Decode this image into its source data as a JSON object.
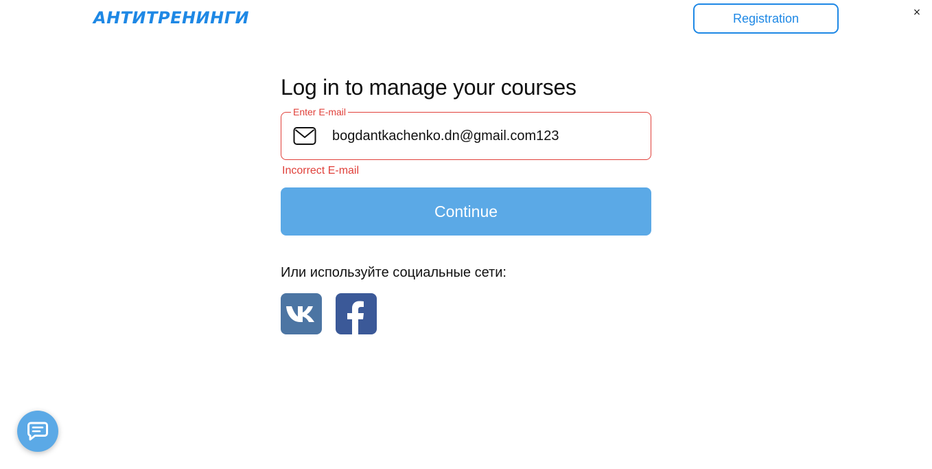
{
  "header": {
    "logo_text": "АНТИТРЕНИНГИ",
    "register_label": "Registration",
    "close_glyph": "×"
  },
  "login": {
    "heading": "Log in to manage your courses",
    "email": {
      "label": "Enter E-mail",
      "value": "bogdantkachenko.dn@gmail.com123",
      "icon": "envelope-icon",
      "error": "Incorrect E-mail"
    },
    "continue_label": "Continue",
    "social": {
      "label": "Или используйте социальные сети:",
      "items": [
        {
          "name": "vk",
          "icon": "vk-icon",
          "color": "#4c75a3"
        },
        {
          "name": "facebook",
          "icon": "facebook-icon",
          "color": "#3b5998"
        }
      ]
    }
  },
  "chat_widget": {
    "icon": "chat-bubble-icon"
  },
  "colors": {
    "accent": "#1e88e5",
    "button": "#5ba9e6",
    "error": "#e0403a",
    "vk": "#4c75a3",
    "facebook": "#3b5998"
  }
}
